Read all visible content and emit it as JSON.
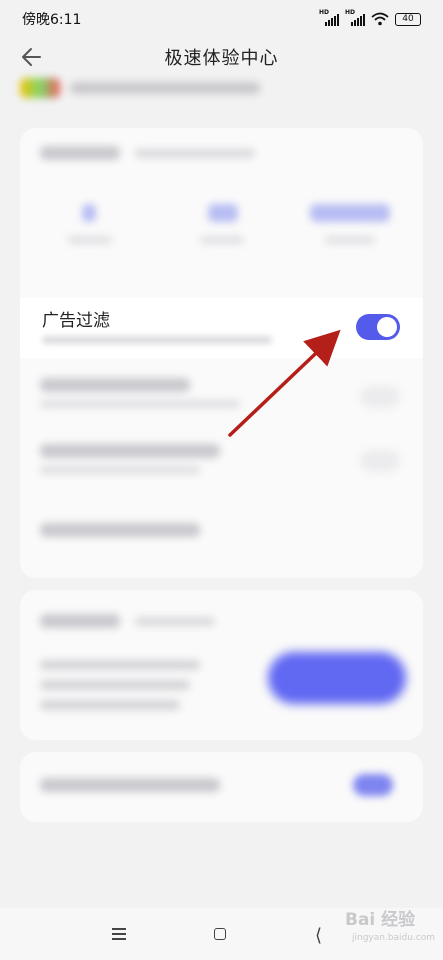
{
  "status_bar": {
    "time": "傍晚6:11",
    "signal_label": "HD",
    "battery": "40"
  },
  "header": {
    "title": "极速体验中心"
  },
  "ad_filter": {
    "label": "广告过滤",
    "enabled": true
  },
  "watermark": {
    "text": "Bai 经验",
    "sub": "jingyan.baidu.com"
  },
  "colors": {
    "accent": "#545bea",
    "arrow": "#b51f1a",
    "background": "#f2f2f3"
  },
  "icons": [
    "back-arrow-icon",
    "wifi-icon",
    "signal-icon",
    "battery-icon",
    "menu-icon",
    "home-icon",
    "nav-back-icon"
  ]
}
